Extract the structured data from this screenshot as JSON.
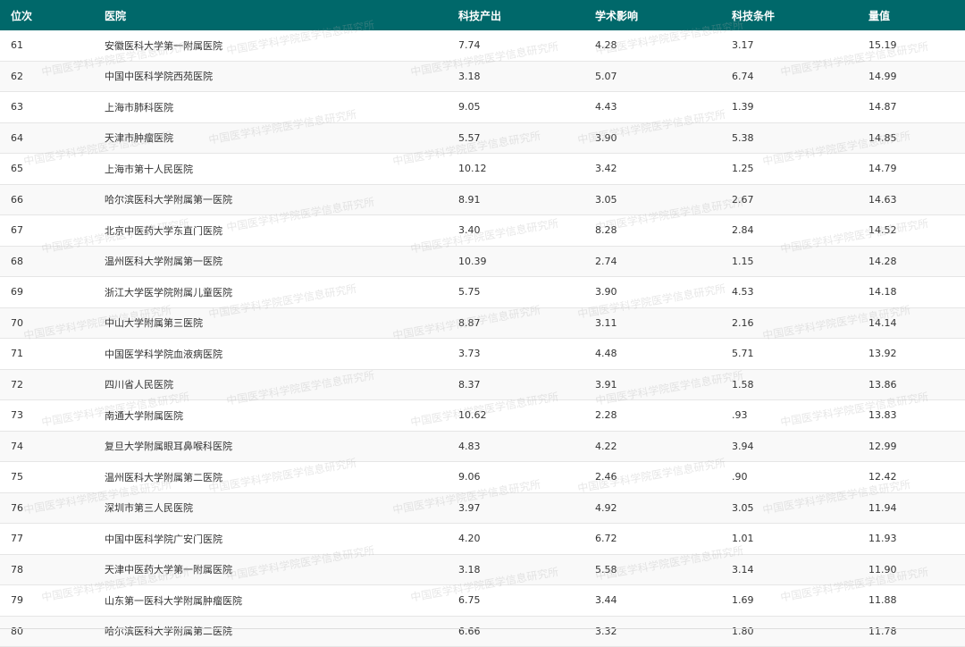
{
  "table": {
    "headers": [
      "位次",
      "医院",
      "科技产出",
      "学术影响",
      "科技条件",
      "量值"
    ],
    "rows": [
      [
        "61",
        "安徽医科大学第一附属医院",
        "7.74",
        "4.28",
        "3.17",
        "15.19"
      ],
      [
        "62",
        "中国中医科学院西苑医院",
        "3.18",
        "5.07",
        "6.74",
        "14.99"
      ],
      [
        "63",
        "上海市肺科医院",
        "9.05",
        "4.43",
        "1.39",
        "14.87"
      ],
      [
        "64",
        "天津市肿瘤医院",
        "5.57",
        "3.90",
        "5.38",
        "14.85"
      ],
      [
        "65",
        "上海市第十人民医院",
        "10.12",
        "3.42",
        "1.25",
        "14.79"
      ],
      [
        "66",
        "哈尔滨医科大学附属第一医院",
        "8.91",
        "3.05",
        "2.67",
        "14.63"
      ],
      [
        "67",
        "北京中医药大学东直门医院",
        "3.40",
        "8.28",
        "2.84",
        "14.52"
      ],
      [
        "68",
        "温州医科大学附属第一医院",
        "10.39",
        "2.74",
        "1.15",
        "14.28"
      ],
      [
        "69",
        "浙江大学医学院附属儿童医院",
        "5.75",
        "3.90",
        "4.53",
        "14.18"
      ],
      [
        "70",
        "中山大学附属第三医院",
        "8.87",
        "3.11",
        "2.16",
        "14.14"
      ],
      [
        "71",
        "中国医学科学院血液病医院",
        "3.73",
        "4.48",
        "5.71",
        "13.92"
      ],
      [
        "72",
        "四川省人民医院",
        "8.37",
        "3.91",
        "1.58",
        "13.86"
      ],
      [
        "73",
        "南通大学附属医院",
        "10.62",
        "2.28",
        ".93",
        "13.83"
      ],
      [
        "74",
        "复旦大学附属眼耳鼻喉科医院",
        "4.83",
        "4.22",
        "3.94",
        "12.99"
      ],
      [
        "75",
        "温州医科大学附属第二医院",
        "9.06",
        "2.46",
        ".90",
        "12.42"
      ],
      [
        "76",
        "深圳市第三人民医院",
        "3.97",
        "4.92",
        "3.05",
        "11.94"
      ],
      [
        "77",
        "中国中医科学院广安门医院",
        "4.20",
        "6.72",
        "1.01",
        "11.93"
      ],
      [
        "78",
        "天津中医药大学第一附属医院",
        "3.18",
        "5.58",
        "3.14",
        "11.90"
      ],
      [
        "79",
        "山东第一医科大学附属肿瘤医院",
        "6.75",
        "3.44",
        "1.69",
        "11.88"
      ],
      [
        "80",
        "哈尔滨医科大学附属第二医院",
        "6.66",
        "3.32",
        "1.80",
        "11.78"
      ]
    ]
  },
  "watermark": {
    "text": "中国医学科学院医学信息研究所",
    "color": "#aaaaaa"
  },
  "colors": {
    "header_bg": "#00686a",
    "header_text": "#ffffff",
    "row_alt": "#f9f9f9"
  }
}
